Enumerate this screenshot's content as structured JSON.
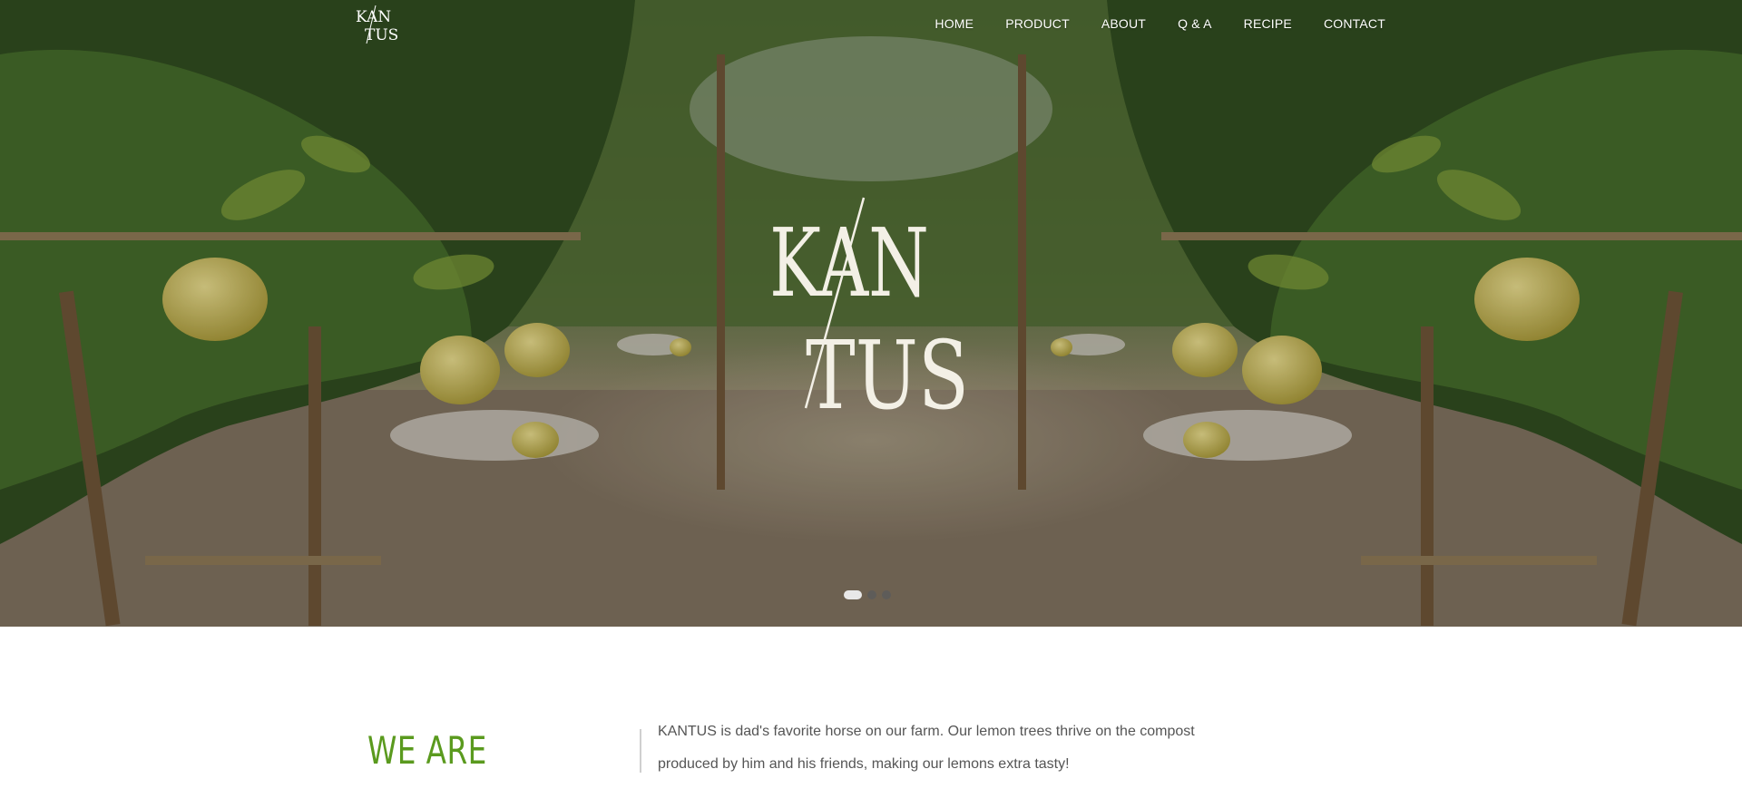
{
  "brand": {
    "name": "KANTUS",
    "logo_line1": "KAN",
    "logo_line2": "TUS"
  },
  "nav": {
    "items": [
      {
        "label": "HOME"
      },
      {
        "label": "PRODUCT"
      },
      {
        "label": "ABOUT"
      },
      {
        "label": "Q & A"
      },
      {
        "label": "RECIPE"
      },
      {
        "label": "CONTACT"
      }
    ]
  },
  "hero": {
    "slide_count": 3,
    "active_slide": 1
  },
  "intro": {
    "heading": "WE ARE",
    "text": " KANTUS is dad's favorite horse on our farm. Our lemon trees thrive on the compost produced by him and his friends, making our lemons extra tasty!"
  },
  "colors": {
    "accent_green": "#5a9a1e",
    "body_text": "#555555",
    "nav_text": "#ffffff"
  }
}
